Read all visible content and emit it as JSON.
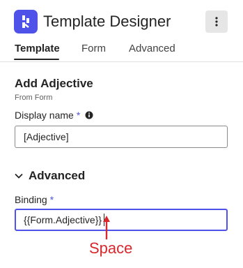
{
  "app": {
    "title": "Template Designer",
    "logo_icon": "app-logo-icon",
    "accent_color": "#4f52e8"
  },
  "header": {
    "more_icon": "more-vertical-icon"
  },
  "tabs": [
    {
      "label": "Template",
      "active": true
    },
    {
      "label": "Form",
      "active": false
    },
    {
      "label": "Advanced",
      "active": false
    }
  ],
  "section": {
    "title": "Add Adjective",
    "subtitle": "From Form"
  },
  "display_name": {
    "label": "Display name",
    "required_mark": "*",
    "info_icon": "info-icon",
    "value": "[Adjective]"
  },
  "advanced": {
    "label": "Advanced",
    "expanded": true,
    "chevron_icon": "chevron-down-icon"
  },
  "binding": {
    "label": "Binding",
    "required_mark": "*",
    "value": "{{Form.Adjective}}"
  },
  "annotation": {
    "label": "Space",
    "color": "#d8282d"
  }
}
